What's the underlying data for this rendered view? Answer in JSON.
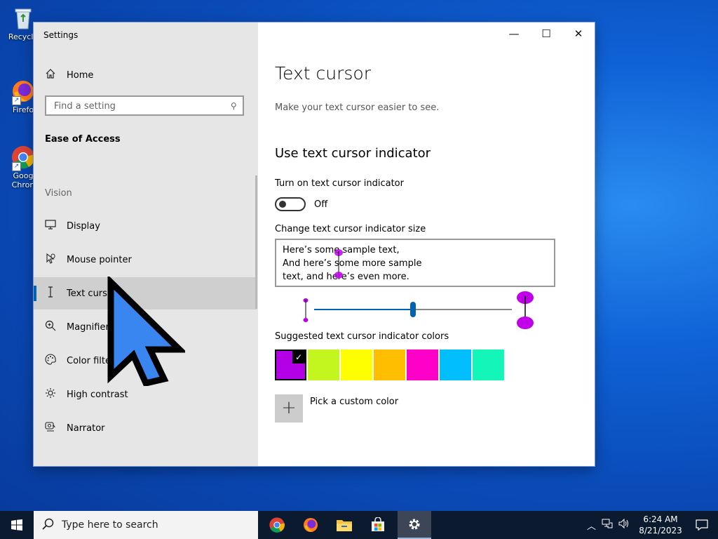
{
  "desktop": {
    "icons": [
      {
        "label": "Recycle",
        "icon": "recycle-bin-icon"
      },
      {
        "label": "Firefo",
        "icon": "firefox-icon"
      },
      {
        "label": "Goog Chron",
        "icon": "chrome-icon"
      }
    ]
  },
  "window": {
    "title": "Settings",
    "controls": {
      "minimize": "—",
      "maximize": "☐",
      "close": "✕"
    }
  },
  "sidebar": {
    "home_label": "Home",
    "search_placeholder": "Find a setting",
    "section_title": "Ease of Access",
    "group_title": "Vision",
    "items": [
      {
        "label": "Display",
        "icon": "display-icon"
      },
      {
        "label": "Mouse pointer",
        "icon": "mouse-pointer-icon"
      },
      {
        "label": "Text cursor",
        "icon": "text-cursor-icon",
        "active": true
      },
      {
        "label": "Magnifier",
        "icon": "magnifier-icon"
      },
      {
        "label": "Color filters",
        "icon": "color-filters-icon"
      },
      {
        "label": "High contrast",
        "icon": "high-contrast-icon"
      },
      {
        "label": "Narrator",
        "icon": "narrator-icon"
      }
    ]
  },
  "content": {
    "title": "Text cursor",
    "description": "Make your text cursor easier to see.",
    "section_title": "Use text cursor indicator",
    "toggle": {
      "label": "Turn on text cursor indicator",
      "state": "Off"
    },
    "size": {
      "label": "Change text cursor indicator size",
      "sample_lines": [
        "Here’s some sample text,",
        "And here’s some more sample",
        "text, and here’s even more."
      ],
      "slider_value": 0.5
    },
    "colors": {
      "label": "Suggested text cursor indicator colors",
      "swatches": [
        "#b400e6",
        "#c3f51e",
        "#ffff00",
        "#ffbe00",
        "#ff00c8",
        "#00beff",
        "#14f5b9"
      ],
      "selected_index": 0
    },
    "custom_color_label": "Pick a custom color",
    "custom_color_symbol": "+"
  },
  "taskbar": {
    "search_placeholder": "Type here to search",
    "apps": [
      "chrome-icon",
      "firefox-icon",
      "file-explorer-icon",
      "store-icon",
      "settings-icon"
    ],
    "time": "6:24 AM",
    "date": "8/21/2023"
  }
}
